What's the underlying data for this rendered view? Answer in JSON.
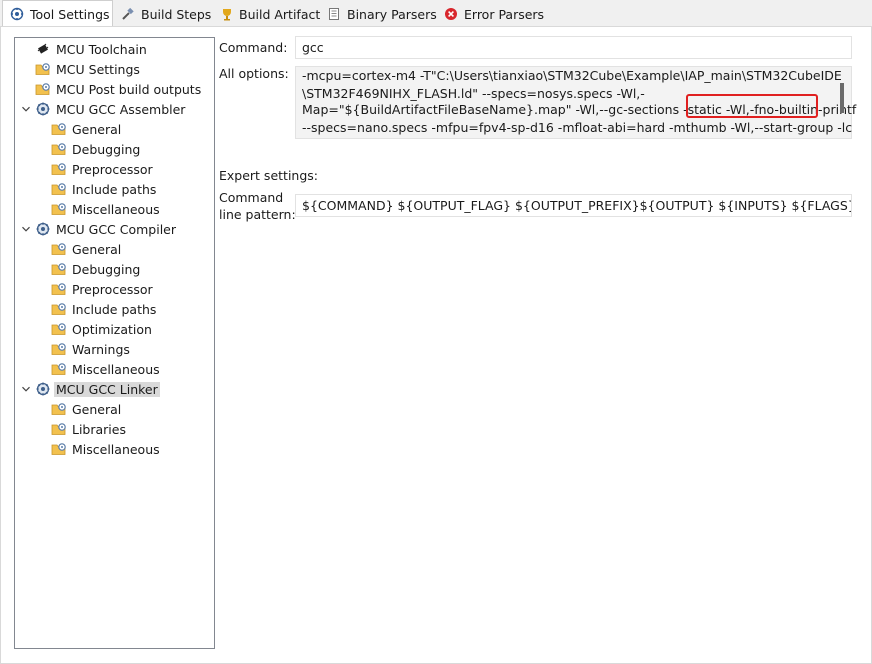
{
  "tabs": [
    {
      "label": "Tool Settings",
      "icon": "tool-settings-icon",
      "active": true
    },
    {
      "label": "Build Steps",
      "icon": "build-steps-icon"
    },
    {
      "label": "Build Artifact",
      "icon": "build-artifact-icon"
    },
    {
      "label": "Binary Parsers",
      "icon": "binary-parsers-icon"
    },
    {
      "label": "Error Parsers",
      "icon": "error-parsers-icon"
    }
  ],
  "tree": [
    {
      "label": "MCU Toolchain",
      "icon": "chip-icon",
      "level": 0
    },
    {
      "label": "MCU Settings",
      "icon": "settings-folder-icon",
      "level": 0
    },
    {
      "label": "MCU Post build outputs",
      "icon": "settings-folder-icon",
      "level": 0
    },
    {
      "label": "MCU GCC Assembler",
      "icon": "gear-icon",
      "level": 0,
      "expanded": true
    },
    {
      "label": "General",
      "icon": "settings-folder-icon",
      "level": 1
    },
    {
      "label": "Debugging",
      "icon": "settings-folder-icon",
      "level": 1
    },
    {
      "label": "Preprocessor",
      "icon": "settings-folder-icon",
      "level": 1
    },
    {
      "label": "Include paths",
      "icon": "settings-folder-icon",
      "level": 1
    },
    {
      "label": "Miscellaneous",
      "icon": "settings-folder-icon",
      "level": 1
    },
    {
      "label": "MCU GCC Compiler",
      "icon": "gear-icon",
      "level": 0,
      "expanded": true
    },
    {
      "label": "General",
      "icon": "settings-folder-icon",
      "level": 1
    },
    {
      "label": "Debugging",
      "icon": "settings-folder-icon",
      "level": 1
    },
    {
      "label": "Preprocessor",
      "icon": "settings-folder-icon",
      "level": 1
    },
    {
      "label": "Include paths",
      "icon": "settings-folder-icon",
      "level": 1
    },
    {
      "label": "Optimization",
      "icon": "settings-folder-icon",
      "level": 1
    },
    {
      "label": "Warnings",
      "icon": "settings-folder-icon",
      "level": 1
    },
    {
      "label": "Miscellaneous",
      "icon": "settings-folder-icon",
      "level": 1
    },
    {
      "label": "MCU GCC Linker",
      "icon": "gear-icon",
      "level": 0,
      "expanded": true,
      "selected": true
    },
    {
      "label": "General",
      "icon": "settings-folder-icon",
      "level": 1
    },
    {
      "label": "Libraries",
      "icon": "settings-folder-icon",
      "level": 1
    },
    {
      "label": "Miscellaneous",
      "icon": "settings-folder-icon",
      "level": 1
    }
  ],
  "settings": {
    "command_label": "Command:",
    "command_value": "gcc",
    "all_options_label": "All options:",
    "all_options_lines": [
      "-mcpu=cortex-m4 -T\"C:\\Users\\tianxiao\\STM32Cube\\Example\\IAP_main\\STM32CubeIDE",
      "\\STM32F469NIHX_FLASH.ld\" --specs=nosys.specs -Wl,-",
      "Map=\"${BuildArtifactFileBaseName}.map\" -Wl,--gc-sections -static -Wl,-fno-builtin-printf",
      "--specs=nano.specs -mfpu=fpv4-sp-d16 -mfloat-abi=hard -mthumb -Wl,--start-group -lc"
    ],
    "expert_label": "Expert settings:",
    "pattern_label_1": "Command",
    "pattern_label_2": "line pattern:",
    "pattern_value": "${COMMAND} ${OUTPUT_FLAG} ${OUTPUT_PREFIX}${OUTPUT} ${INPUTS} ${FLAGS}"
  },
  "colors": {
    "highlight_box": "#e02020",
    "selection": "#d9d9d9"
  }
}
